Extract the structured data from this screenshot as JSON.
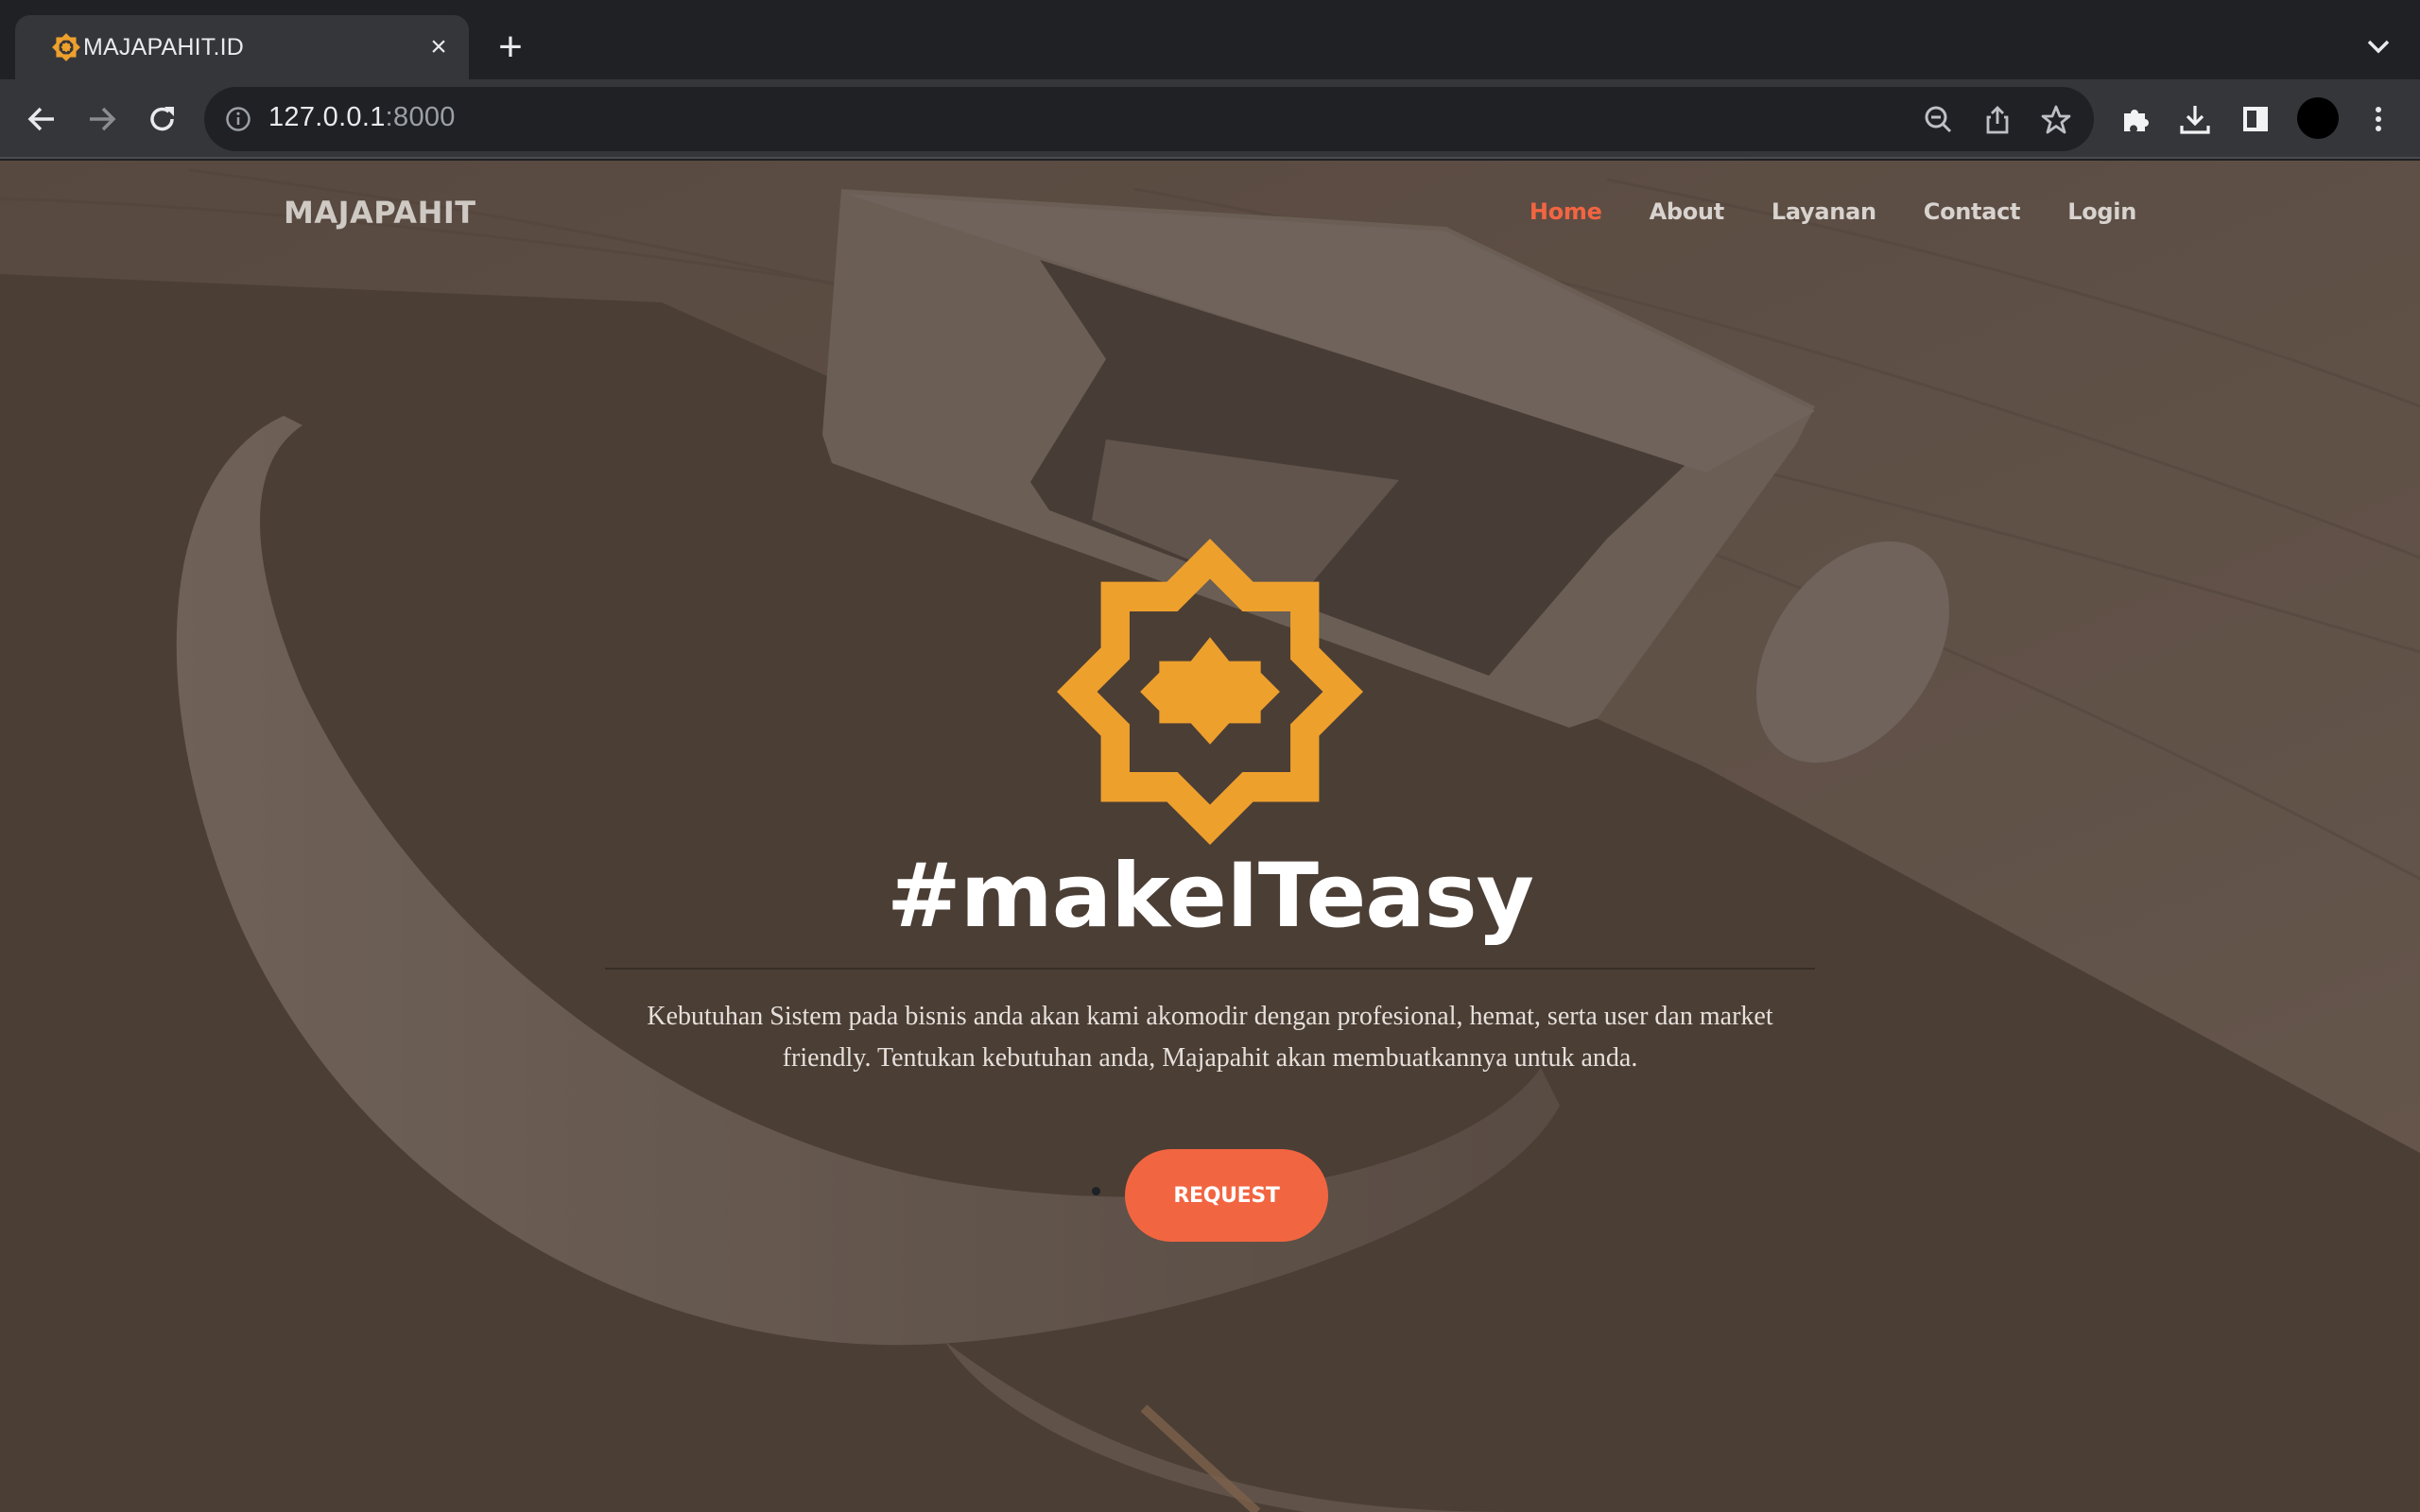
{
  "browser": {
    "tab": {
      "title": "MAJAPAHIT.ID",
      "favicon": "majapahit-star-icon",
      "close_label": "×"
    },
    "new_tab_label": "+",
    "toolbar": {
      "back_icon": "arrow-left-icon",
      "forward_icon": "arrow-right-icon",
      "reload_icon": "reload-icon",
      "site_info_icon": "info-icon",
      "url_host": "127.0.0.1",
      "url_port": ":8000",
      "zoom_icon": "zoom-out-icon",
      "share_icon": "share-icon",
      "bookmark_icon": "star-icon",
      "extensions_icon": "puzzle-icon",
      "downloads_icon": "download-icon",
      "side_panel_icon": "side-panel-icon",
      "profile_icon": "avatar",
      "menu_icon": "kebab-menu-icon"
    }
  },
  "page": {
    "brand": "MAJAPAHIT",
    "nav": [
      {
        "label": "Home",
        "active": true
      },
      {
        "label": "About",
        "active": false
      },
      {
        "label": "Layanan",
        "active": false
      },
      {
        "label": "Contact",
        "active": false
      },
      {
        "label": "Login",
        "active": false
      }
    ],
    "hero": {
      "logo": "majapahit-star-icon",
      "title": "#makeITeasy",
      "description": "Kebutuhan Sistem pada bisnis anda akan kami akomodir dengan profesional, hemat, serta user dan market friendly. Tentukan kebutuhan anda, Majapahit akan membuatkannya untuk anda.",
      "cta_label": "REQUEST"
    },
    "colors": {
      "accent": "#f26541",
      "logo": "#eea02d",
      "overlay": "#4f4339"
    }
  }
}
